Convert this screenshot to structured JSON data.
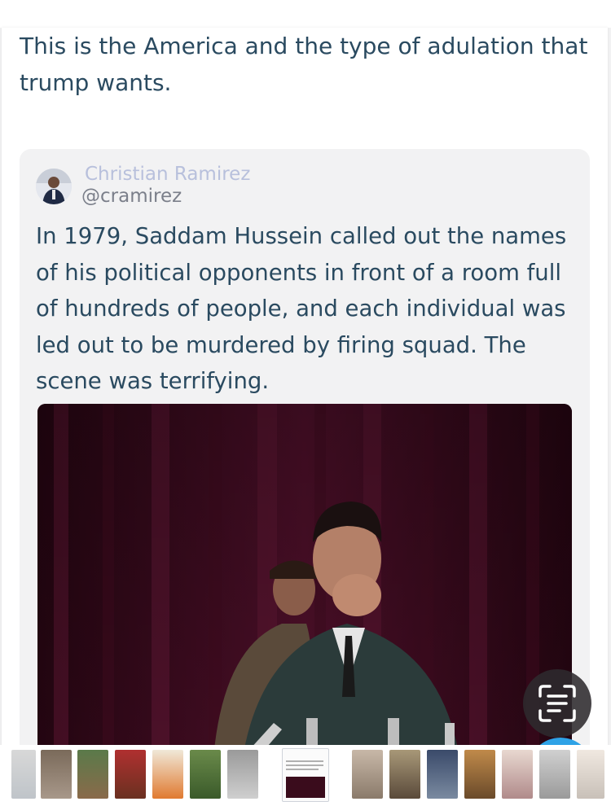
{
  "post": {
    "text": "This is the America and the type of adulation that trump wants."
  },
  "tweet": {
    "author_name": "Christian Ramirez",
    "author_handle": "@cramirez",
    "text": "In 1979, Saddam Hussein called out the names of his political opponents in front of a room full of hundreds of people, and each individual was led out to be murdered by firing squad. The scene was terrifying.",
    "media_icon": "video-still-image"
  },
  "overlay": {
    "scan_icon": "text-scan-icon"
  },
  "colors": {
    "text": "#2a4a60",
    "author_name": "#b8c0dc",
    "handle": "#7b7f8a",
    "card_background": "#f2f2f3",
    "accent_blue": "#2ea2e6"
  },
  "thumbnails": [
    {
      "name": "thumb-1"
    },
    {
      "name": "thumb-2"
    },
    {
      "name": "thumb-3"
    },
    {
      "name": "thumb-4"
    },
    {
      "name": "thumb-5"
    },
    {
      "name": "thumb-6"
    },
    {
      "name": "thumb-7"
    },
    {
      "name": "thumb-8"
    },
    {
      "name": "thumb-9"
    },
    {
      "name": "thumb-10"
    },
    {
      "name": "thumb-11"
    },
    {
      "name": "thumb-12"
    },
    {
      "name": "thumb-13"
    },
    {
      "name": "thumb-14"
    },
    {
      "name": "thumb-15"
    },
    {
      "name": "thumb-16"
    }
  ]
}
